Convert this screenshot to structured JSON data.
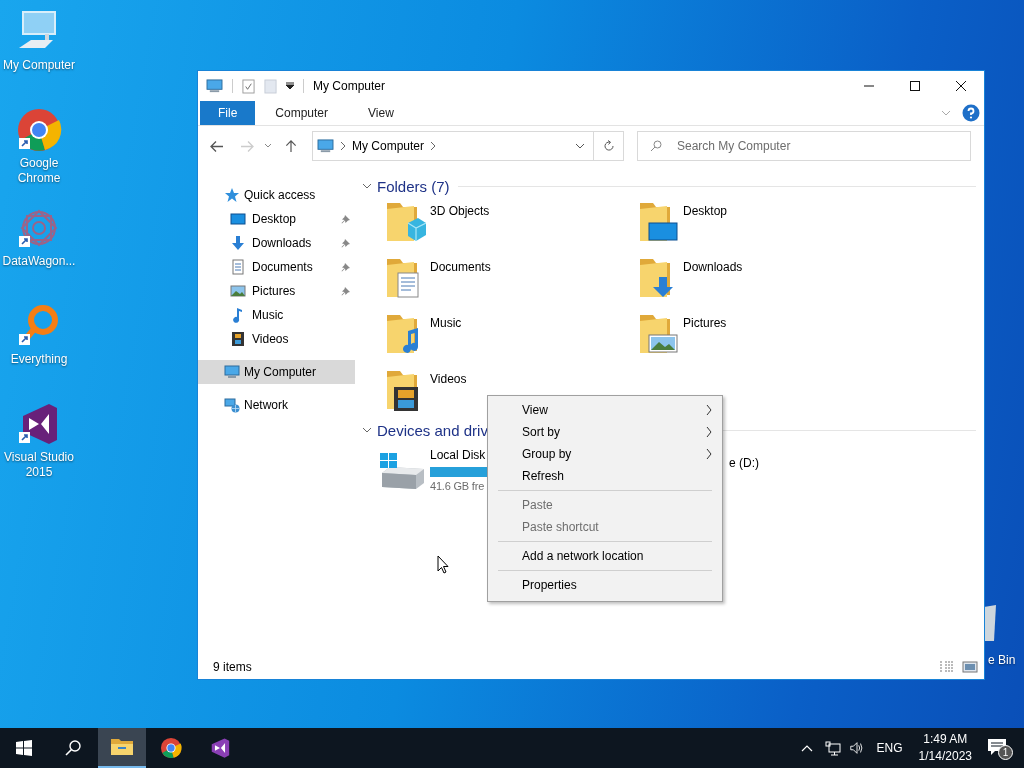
{
  "desktop_icons": [
    {
      "label": "My Computer",
      "kind": "computer",
      "shortcut": false
    },
    {
      "label": "Google Chrome",
      "kind": "chrome",
      "shortcut": true
    },
    {
      "label": "DataWagon...",
      "kind": "datawagon",
      "shortcut": true
    },
    {
      "label": "Everything",
      "kind": "everything",
      "shortcut": true
    },
    {
      "label": "Visual Studio 2015",
      "kind": "vs",
      "shortcut": true
    }
  ],
  "recycle_bin": {
    "label": "e Bin"
  },
  "window": {
    "title": "My Computer",
    "ribbon_tabs": [
      {
        "label": "File",
        "kind": "file"
      },
      {
        "label": "Computer",
        "kind": "tab"
      },
      {
        "label": "View",
        "kind": "tab"
      }
    ],
    "address": {
      "path": "My Computer"
    },
    "search": {
      "placeholder": "Search My Computer"
    },
    "nav": [
      {
        "label": "Quick access",
        "kind": "star",
        "selected": false,
        "children": [
          {
            "label": "Desktop",
            "kind": "desktop",
            "pinned": true,
            "selected": false
          },
          {
            "label": "Downloads",
            "kind": "downloads",
            "pinned": true,
            "selected": false
          },
          {
            "label": "Documents",
            "kind": "documents",
            "pinned": true,
            "selected": false
          },
          {
            "label": "Pictures",
            "kind": "pictures",
            "pinned": true,
            "selected": false
          },
          {
            "label": "Music",
            "kind": "music",
            "pinned": false,
            "selected": false
          },
          {
            "label": "Videos",
            "kind": "videos",
            "pinned": false,
            "selected": false
          }
        ]
      },
      {
        "label": "My Computer",
        "kind": "computer",
        "selected": true
      },
      {
        "label": "Network",
        "kind": "network",
        "selected": false
      }
    ],
    "groups": [
      {
        "title": "Folders (7)",
        "kind": "folders",
        "items": [
          {
            "name": "3D Objects",
            "kind": "objects"
          },
          {
            "name": "Desktop",
            "kind": "desktop"
          },
          {
            "name": "Documents",
            "kind": "documents"
          },
          {
            "name": "Downloads",
            "kind": "downloads"
          },
          {
            "name": "Music",
            "kind": "music"
          },
          {
            "name": "Pictures",
            "kind": "pictures"
          },
          {
            "name": "Videos",
            "kind": "videos"
          }
        ]
      },
      {
        "title": "Devices and driv",
        "kind": "drives",
        "items": [
          {
            "name": "Local Disk",
            "free": "41.6 GB fre",
            "kind": "system"
          },
          {
            "name": "e (D:)",
            "kind": "covered"
          }
        ]
      }
    ],
    "status": "9 items"
  },
  "context_menu": {
    "items": [
      {
        "kind": "item",
        "label": "View",
        "submenu": true,
        "disabled": false
      },
      {
        "kind": "item",
        "label": "Sort by",
        "submenu": true,
        "disabled": false
      },
      {
        "kind": "item",
        "label": "Group by",
        "submenu": true,
        "disabled": false
      },
      {
        "kind": "item",
        "label": "Refresh",
        "submenu": false,
        "disabled": false
      },
      {
        "kind": "separator"
      },
      {
        "kind": "item",
        "label": "Paste",
        "submenu": false,
        "disabled": true
      },
      {
        "kind": "item",
        "label": "Paste shortcut",
        "submenu": false,
        "disabled": true
      },
      {
        "kind": "separator"
      },
      {
        "kind": "item",
        "label": "Add a network location",
        "submenu": false,
        "disabled": false
      },
      {
        "kind": "separator"
      },
      {
        "kind": "item",
        "label": "Properties",
        "submenu": false,
        "disabled": false
      }
    ]
  },
  "taskbar": {
    "apps": [
      {
        "kind": "start",
        "active": false
      },
      {
        "kind": "search",
        "active": false
      },
      {
        "kind": "explorer",
        "active": true
      },
      {
        "kind": "chrome",
        "active": false
      },
      {
        "kind": "vs",
        "active": false
      }
    ],
    "language": "ENG",
    "time": "1:49 AM",
    "date": "1/14/2023",
    "notification_count": "1"
  }
}
